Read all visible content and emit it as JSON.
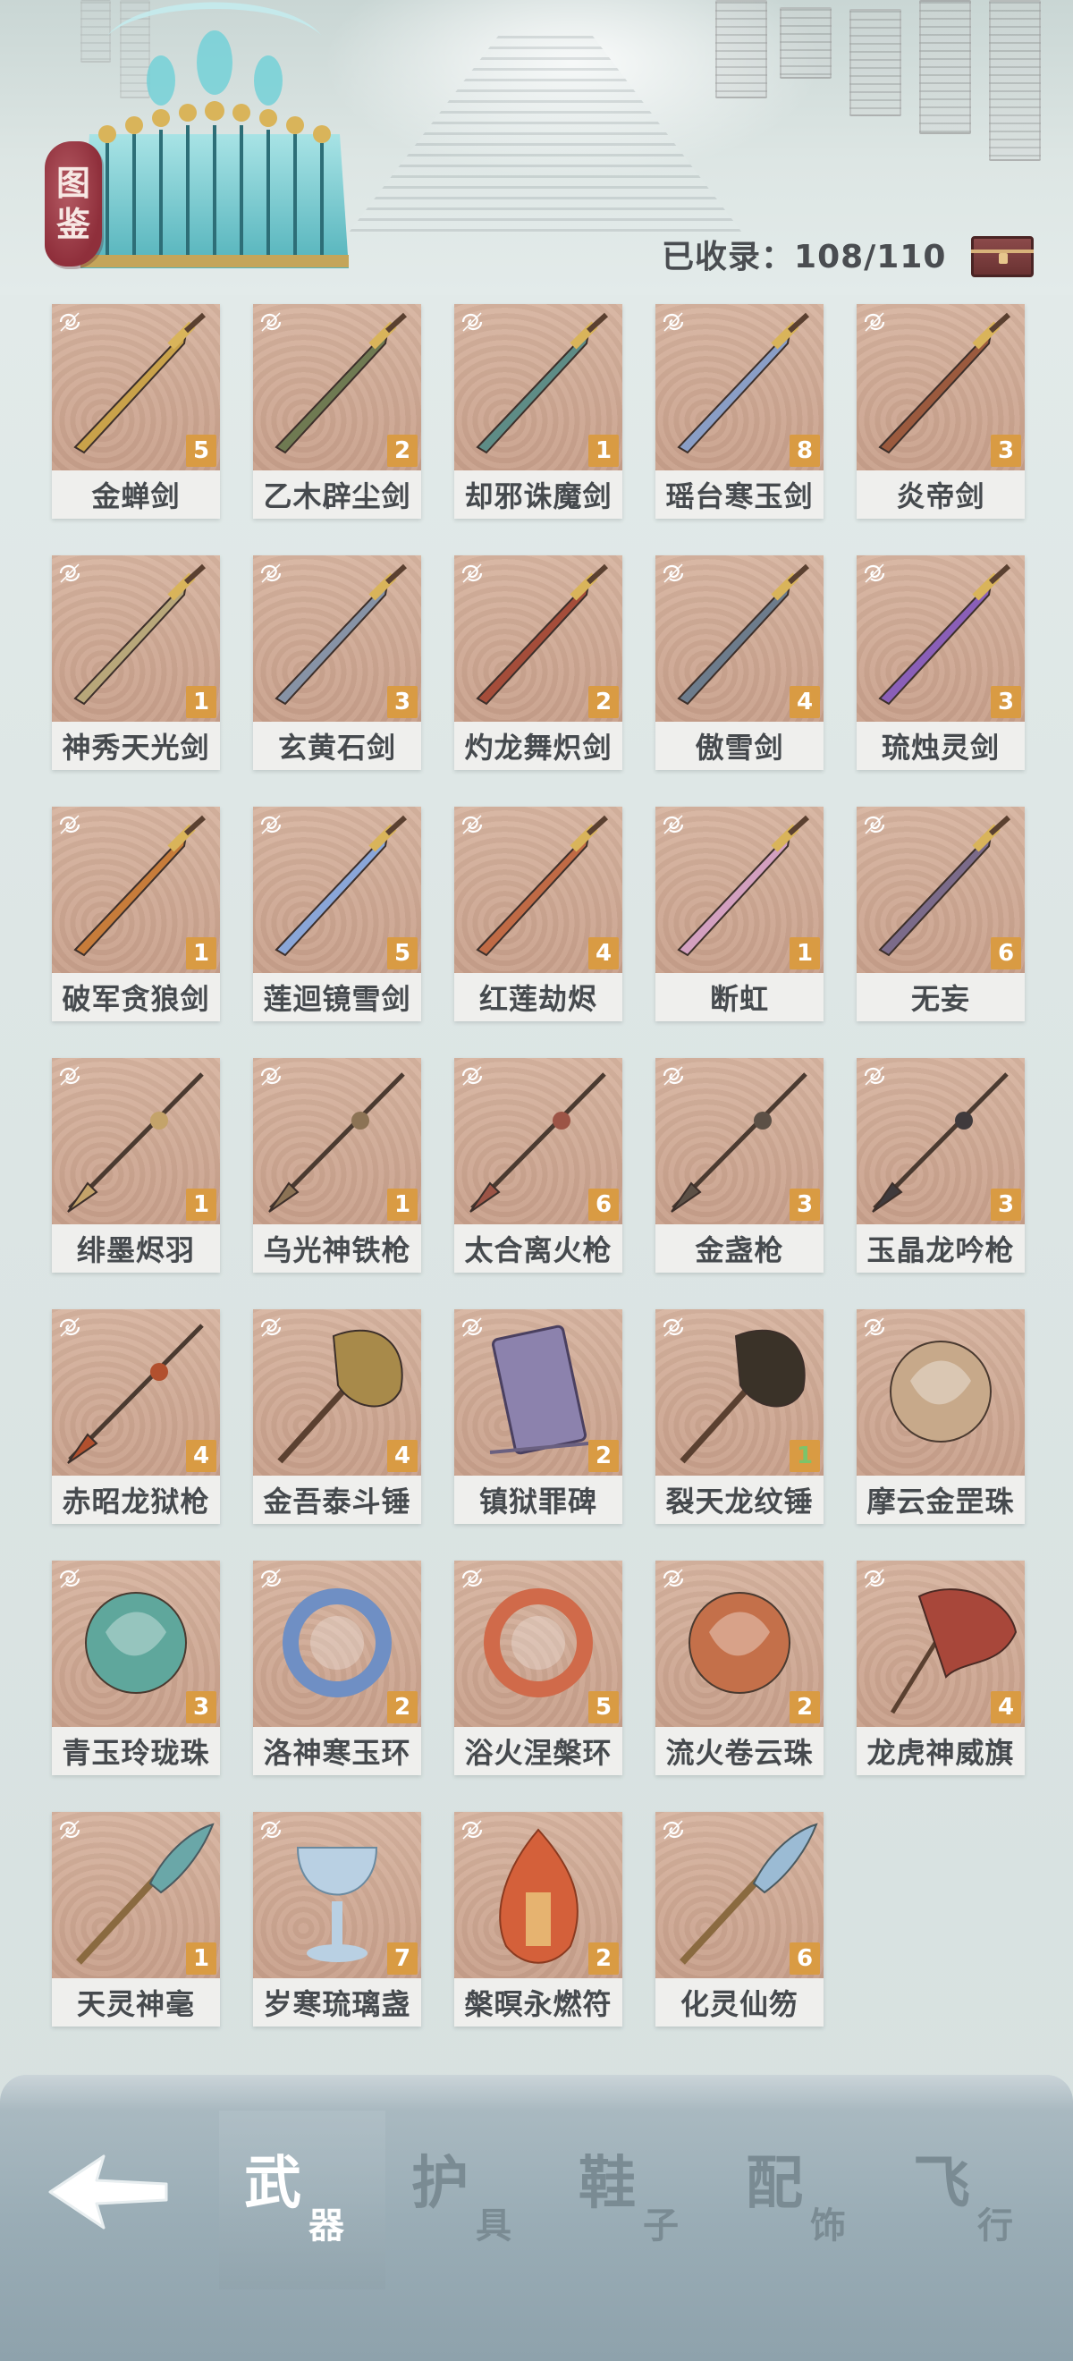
{
  "header": {
    "seal_chars": [
      "图",
      "鉴"
    ],
    "collected_label": "已收录：",
    "collected_value": "108/110"
  },
  "items": [
    {
      "name": "金蝉剑",
      "count": "5",
      "kind": "sword",
      "color": "#c9a24a"
    },
    {
      "name": "乙木辟尘剑",
      "count": "2",
      "kind": "sword",
      "color": "#6f7a52"
    },
    {
      "name": "却邪诛魔剑",
      "count": "1",
      "kind": "sword",
      "color": "#5e8c86"
    },
    {
      "name": "瑶台寒玉剑",
      "count": "8",
      "kind": "sword",
      "color": "#8a9ec6"
    },
    {
      "name": "炎帝剑",
      "count": "3",
      "kind": "sword",
      "color": "#9b5a3e"
    },
    {
      "name": "神秀天光剑",
      "count": "1",
      "kind": "sword",
      "color": "#b8a77a"
    },
    {
      "name": "玄黄石剑",
      "count": "3",
      "kind": "sword",
      "color": "#8793a6"
    },
    {
      "name": "灼龙舞炽剑",
      "count": "2",
      "kind": "sword",
      "color": "#a54d3a"
    },
    {
      "name": "傲雪剑",
      "count": "4",
      "kind": "sword",
      "color": "#6d7c8c"
    },
    {
      "name": "琉烛灵剑",
      "count": "3",
      "kind": "sword",
      "color": "#8a5fb8"
    },
    {
      "name": "破军贪狼剑",
      "count": "1",
      "kind": "sword",
      "color": "#c77c3a"
    },
    {
      "name": "莲迴镜雪剑",
      "count": "5",
      "kind": "sword",
      "color": "#8aa6d8"
    },
    {
      "name": "红莲劫烬",
      "count": "4",
      "kind": "sword",
      "color": "#c06a45"
    },
    {
      "name": "断虹",
      "count": "1",
      "kind": "sword",
      "color": "#d3a0c0"
    },
    {
      "name": "无妄",
      "count": "6",
      "kind": "sword",
      "color": "#7b6b8a"
    },
    {
      "name": "绯墨烬羽",
      "count": "1",
      "kind": "spear",
      "color": "#c4a36a"
    },
    {
      "name": "乌光神铁枪",
      "count": "1",
      "kind": "spear",
      "color": "#8c7355"
    },
    {
      "name": "太合离火枪",
      "count": "6",
      "kind": "spear",
      "color": "#9c5446"
    },
    {
      "name": "金盏枪",
      "count": "3",
      "kind": "spear",
      "color": "#5c5046"
    },
    {
      "name": "玉晶龙吟枪",
      "count": "3",
      "kind": "spear",
      "color": "#3f3a3c"
    },
    {
      "name": "赤昭龙狱枪",
      "count": "4",
      "kind": "spear",
      "color": "#b2502e"
    },
    {
      "name": "金吾泰斗锤",
      "count": "4",
      "kind": "hammer",
      "color": "#a88a4a"
    },
    {
      "name": "镇狱罪碑",
      "count": "2",
      "kind": "tablet",
      "color": "#8c82ad"
    },
    {
      "name": "裂天龙纹锤",
      "count": "1",
      "kind": "hammer",
      "color": "#3a3228",
      "green": true
    },
    {
      "name": "摩云金罡珠",
      "count": "",
      "kind": "orb",
      "color": "#c7a98a"
    },
    {
      "name": "青玉玲珑珠",
      "count": "3",
      "kind": "orb",
      "color": "#5fa79c"
    },
    {
      "name": "洛神寒玉环",
      "count": "2",
      "kind": "ring",
      "color": "#6f8fc4"
    },
    {
      "name": "浴火涅槃环",
      "count": "5",
      "kind": "ring",
      "color": "#d06a4a"
    },
    {
      "name": "流火卷云珠",
      "count": "2",
      "kind": "orb",
      "color": "#c4704a"
    },
    {
      "name": "龙虎神威旗",
      "count": "4",
      "kind": "flag",
      "color": "#a8473a"
    },
    {
      "name": "天灵神毫",
      "count": "1",
      "kind": "brush",
      "color": "#6aa7a8"
    },
    {
      "name": "岁寒琉璃盏",
      "count": "7",
      "kind": "cup",
      "color": "#b9d0e3"
    },
    {
      "name": "槃暝永燃符",
      "count": "2",
      "kind": "flame",
      "color": "#d4603a"
    },
    {
      "name": "化灵仙笏",
      "count": "6",
      "kind": "brush",
      "color": "#9bbbd4"
    }
  ],
  "nav": {
    "tabs": [
      {
        "big": "武",
        "small": "器",
        "active": true
      },
      {
        "big": "护",
        "small": "具",
        "active": false
      },
      {
        "big": "鞋",
        "small": "子",
        "active": false
      },
      {
        "big": "配",
        "small": "饰",
        "active": false
      },
      {
        "big": "飞",
        "small": "行",
        "active": false
      }
    ]
  },
  "colors": {
    "card_art_bg": "#c8a08b",
    "count_badge": "#d99b43",
    "seal_red": "#8f2f3b",
    "nav_bar": "#9aadb6"
  }
}
